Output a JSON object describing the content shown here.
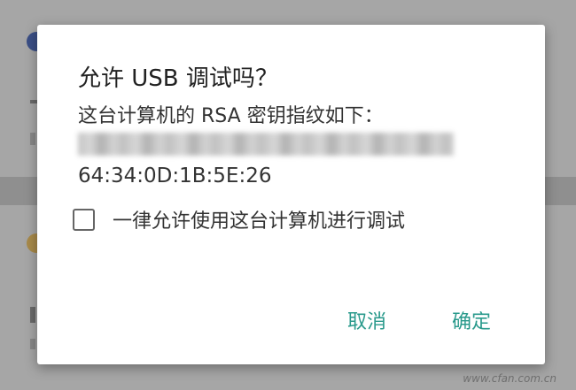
{
  "dialog": {
    "title": "允许 USB 调试吗？",
    "message": "这台计算机的 RSA 密钥指纹如下：",
    "fingerprint_tail": "64:34:0D:1B:5E:26",
    "checkbox_label": "一律允许使用这台计算机进行调试",
    "checkbox_checked": false,
    "cancel_label": "取消",
    "ok_label": "确定"
  },
  "colors": {
    "accent": "#2a9a8c",
    "scrim": "#9c9c9c",
    "dialog_bg": "#ffffff"
  },
  "watermark": "www.cfan.com.cn"
}
